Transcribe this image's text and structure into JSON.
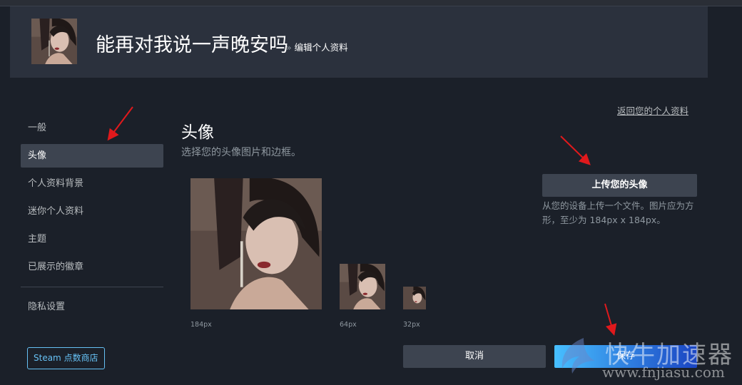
{
  "profile": {
    "name": "能再对我说一声晚安吗",
    "breadcrumb_sep": "»",
    "breadcrumb": "编辑个人资料"
  },
  "sidebar": {
    "items": [
      {
        "label": "一般"
      },
      {
        "label": "头像",
        "active": true
      },
      {
        "label": "个人资料背景"
      },
      {
        "label": "迷你个人资料"
      },
      {
        "label": "主题"
      },
      {
        "label": "已展示的徽章"
      }
    ],
    "privacy_label": "隐私设置",
    "store_button": "Steam 点数商店"
  },
  "main": {
    "return_link": "返回您的个人资料",
    "title": "头像",
    "subtitle": "选择您的头像图片和边框。",
    "sizes": [
      "184px",
      "64px",
      "32px"
    ],
    "upload_button": "上传您的头像",
    "upload_hint": "从您的设备上传一个文件。图片应为方形，至少为 184px x 184px。",
    "cancel_button": "取消",
    "save_button": "保存"
  },
  "watermark": {
    "brand": "快牛加速器",
    "url": "www.fnjiasu.com"
  },
  "colors": {
    "background": "#1b2029",
    "header": "#2b313d",
    "active_item": "#3d4450",
    "accent": "#66c0f4",
    "save_gradient_start": "#47bfff",
    "save_gradient_end": "#1a44c2",
    "annotation_arrow": "#e0191c"
  }
}
